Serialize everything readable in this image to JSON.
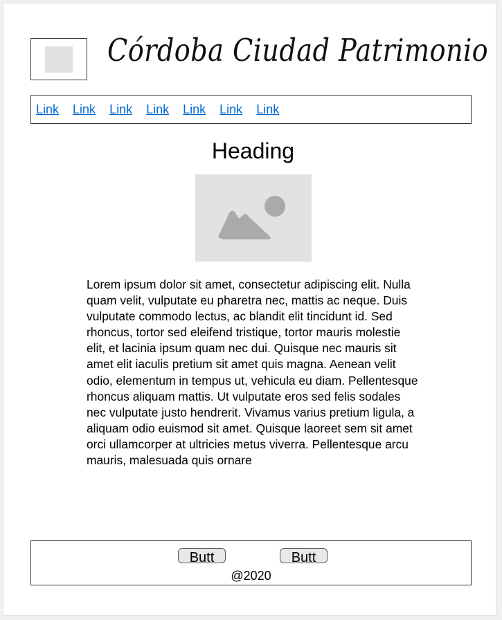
{
  "header": {
    "title": "Córdoba Ciudad Patrimonio"
  },
  "nav": {
    "links": [
      "Link",
      "Link",
      "Link",
      "Link",
      "Link",
      "Link",
      "Link"
    ]
  },
  "main": {
    "heading": "Heading",
    "body": "Lorem ipsum dolor sit amet, consectetur adipiscing elit. Nulla quam velit, vulputate eu pharetra nec, mattis ac neque. Duis vulputate commodo lectus, ac blandit elit tincidunt id. Sed rhoncus, tortor sed eleifend tristique, tortor mauris molestie elit, et lacinia ipsum quam nec dui. Quisque nec mauris sit amet elit iaculis pretium sit amet quis magna. Aenean velit odio, elementum in tempus ut, vehicula eu diam. Pellentesque rhoncus aliquam mattis. Ut vulputate eros sed felis sodales nec vulputate justo hendrerit. Vivamus varius pretium ligula, a aliquam odio euismod sit amet. Quisque laoreet sem sit amet orci ullamcorper at ultricies metus viverra. Pellentesque arcu mauris, malesuada quis ornare"
  },
  "footer": {
    "button1_label": "Butt",
    "button2_label": "Butt",
    "copyright": "@2020"
  },
  "icons": {
    "logo": "logo-placeholder-icon",
    "image": "image-placeholder-icon"
  },
  "colors": {
    "link": "#0066cc",
    "placeholder": "#e2e2e2",
    "placeholder_glyph": "#aaaaaa"
  }
}
